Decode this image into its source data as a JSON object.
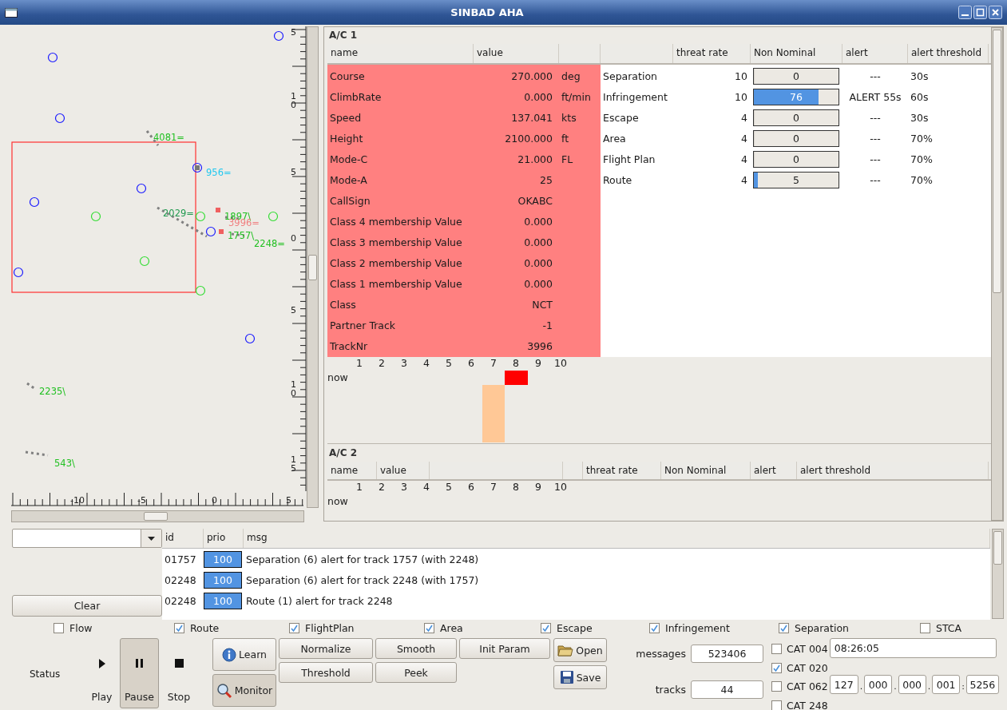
{
  "window": {
    "title": "SINBAD AHA"
  },
  "radar": {
    "y_ruler": [
      "5",
      "10",
      "5",
      "0",
      "5",
      "10",
      "15"
    ],
    "x_ruler": [
      "-10",
      "-5",
      "0",
      "5"
    ],
    "tracks": [
      {
        "label": "4081=",
        "color": "#22c022"
      },
      {
        "label": "956=",
        "color": "#22c8f0"
      },
      {
        "label": "2029=",
        "color": "#229a50"
      },
      {
        "label": "1897\\",
        "color": "#22c022"
      },
      {
        "label": "3996=",
        "color": "#f08080"
      },
      {
        "label": "1757\\",
        "color": "#22c022"
      },
      {
        "label": "2248=",
        "color": "#22c022"
      },
      {
        "label": "2235\\",
        "color": "#22c022"
      },
      {
        "label": "543\\",
        "color": "#22c022"
      }
    ]
  },
  "aircraft": [
    {
      "title": "A/C 1",
      "columns": [
        {
          "kind": "text",
          "label": "name"
        },
        {
          "kind": "text",
          "label": "value"
        },
        {
          "kind": "blank"
        },
        {
          "kind": "blank"
        },
        {
          "kind": "text",
          "label": "threat rate"
        },
        {
          "kind": "text",
          "label": "Non Nominal"
        },
        {
          "kind": "text",
          "label": "alert"
        },
        {
          "kind": "text",
          "label": "alert threshold"
        }
      ],
      "rows": [
        {
          "name": "Course",
          "value": "270.000",
          "unit": "deg"
        },
        {
          "name": "ClimbRate",
          "value": "0.000",
          "unit": "ft/min"
        },
        {
          "name": "Speed",
          "value": "137.041",
          "unit": "kts"
        },
        {
          "name": "Height",
          "value": "2100.000",
          "unit": "ft"
        },
        {
          "name": "Mode-C",
          "value": "21.000",
          "unit": "FL"
        },
        {
          "name": "Mode-A",
          "value": "25"
        },
        {
          "name": "CallSign",
          "value": "OKABC"
        },
        {
          "name": "Class 4 membership Value",
          "value": "0.000"
        },
        {
          "name": "Class 3 membership Value",
          "value": "0.000"
        },
        {
          "name": "Class 2 membership Value",
          "value": "0.000"
        },
        {
          "name": "Class 1 membership Value",
          "value": "0.000"
        },
        {
          "name": "Class",
          "value": "NCT"
        },
        {
          "name": "Partner Track",
          "value": "-1"
        },
        {
          "name": "TrackNr",
          "value": "3996"
        }
      ],
      "threats": [
        {
          "name": "Separation",
          "threat_rate": "10",
          "level": 0,
          "reading": "0",
          "alert": "---",
          "alert_threshold": "30s"
        },
        {
          "name": "Infringement",
          "threat_rate": "10",
          "level": 0.76,
          "reading": "76",
          "alert": "ALERT  55s",
          "alert_threshold": "60s"
        },
        {
          "name": "Escape",
          "threat_rate": "4",
          "level": 0,
          "reading": "0",
          "alert": "---",
          "alert_threshold": "30s"
        },
        {
          "name": "Area",
          "threat_rate": "4",
          "level": 0,
          "reading": "0",
          "alert": "---",
          "alert_threshold": "70%"
        },
        {
          "name": "Flight Plan",
          "threat_rate": "4",
          "level": 0,
          "reading": "0",
          "alert": "---",
          "alert_threshold": "70%"
        },
        {
          "name": "Route",
          "threat_rate": "4",
          "level": 0.05,
          "reading": "5",
          "alert": "---",
          "alert_threshold": "70%"
        }
      ],
      "timeline": {
        "now": "now",
        "slots": [
          {
            "label": "1",
            "kind": "none"
          },
          {
            "label": "2",
            "kind": "none"
          },
          {
            "label": "3",
            "kind": "none"
          },
          {
            "label": "4",
            "kind": "none"
          },
          {
            "label": "5",
            "kind": "none"
          },
          {
            "label": "6",
            "kind": "none"
          },
          {
            "label": "7",
            "kind": "history"
          },
          {
            "label": "8",
            "kind": "alert"
          },
          {
            "label": "9",
            "kind": "none"
          },
          {
            "label": "10",
            "kind": "none"
          }
        ]
      }
    },
    {
      "title": "A/C 2",
      "columns": [
        {
          "kind": "text",
          "label": "name"
        },
        {
          "kind": "text",
          "label": "value"
        },
        {
          "kind": "blank"
        },
        {
          "kind": "blank"
        },
        {
          "kind": "text",
          "label": "threat rate"
        },
        {
          "kind": "text",
          "label": "Non Nominal"
        },
        {
          "kind": "text",
          "label": "alert"
        },
        {
          "kind": "text",
          "label": "alert threshold"
        }
      ],
      "timeline": {
        "now": "now",
        "slots": [
          {
            "label": "1",
            "kind": "none"
          },
          {
            "label": "2",
            "kind": "none"
          },
          {
            "label": "3",
            "kind": "none"
          },
          {
            "label": "4",
            "kind": "none"
          },
          {
            "label": "5",
            "kind": "none"
          },
          {
            "label": "6",
            "kind": "none"
          },
          {
            "label": "7",
            "kind": "none"
          },
          {
            "label": "8",
            "kind": "none"
          },
          {
            "label": "9",
            "kind": "none"
          },
          {
            "label": "10",
            "kind": "none"
          }
        ]
      }
    }
  ],
  "messages": {
    "clear": "Clear",
    "columns": [
      "id",
      "prio",
      "msg"
    ],
    "rows": [
      {
        "id": "01757",
        "prio": "100",
        "msg": "Separation (6) alert for track 1757 (with 2248)"
      },
      {
        "id": "02248",
        "prio": "100",
        "msg": "Separation (6) alert for track 2248 (with 1757)"
      },
      {
        "id": "02248",
        "prio": "100",
        "msg": "Route (1) alert for track 2248"
      }
    ]
  },
  "filters": [
    {
      "label": "Flow",
      "checked": false
    },
    {
      "label": "Route",
      "checked": true
    },
    {
      "label": "FlightPlan",
      "checked": true
    },
    {
      "label": "Area",
      "checked": true
    },
    {
      "label": "Escape",
      "checked": true
    },
    {
      "label": "Infringement",
      "checked": true
    },
    {
      "label": "Separation",
      "checked": true
    },
    {
      "label": "STCA",
      "checked": false
    }
  ],
  "status_label": "Status",
  "transport": [
    {
      "label": "Play",
      "kind": "play",
      "selected": false
    },
    {
      "label": "Pause",
      "kind": "pause",
      "selected": true
    },
    {
      "label": "Stop",
      "kind": "stop",
      "selected": false
    }
  ],
  "modes": [
    {
      "label": "Learn",
      "kind": "info",
      "selected": false
    },
    {
      "label": "Monitor",
      "kind": "search",
      "selected": true
    }
  ],
  "actions": [
    "Normalize",
    "Smooth",
    "Init Param",
    "Threshold",
    "Peek"
  ],
  "file_buttons": [
    {
      "label": "Open",
      "kind": "open"
    },
    {
      "label": "Save",
      "kind": "save"
    }
  ],
  "counters": [
    {
      "label": "messages",
      "value": "523406"
    },
    {
      "label": "tracks",
      "value": "44"
    }
  ],
  "categories": [
    {
      "label": "CAT 004",
      "checked": false
    },
    {
      "label": "CAT 020",
      "checked": true
    },
    {
      "label": "CAT 062",
      "checked": false
    },
    {
      "label": "CAT 248",
      "checked": false
    }
  ],
  "time": "08:26:05",
  "address": {
    "parts": [
      "127",
      "000",
      "000",
      "001"
    ],
    "separator": ".",
    "port_separator": ":",
    "port": "5256"
  }
}
